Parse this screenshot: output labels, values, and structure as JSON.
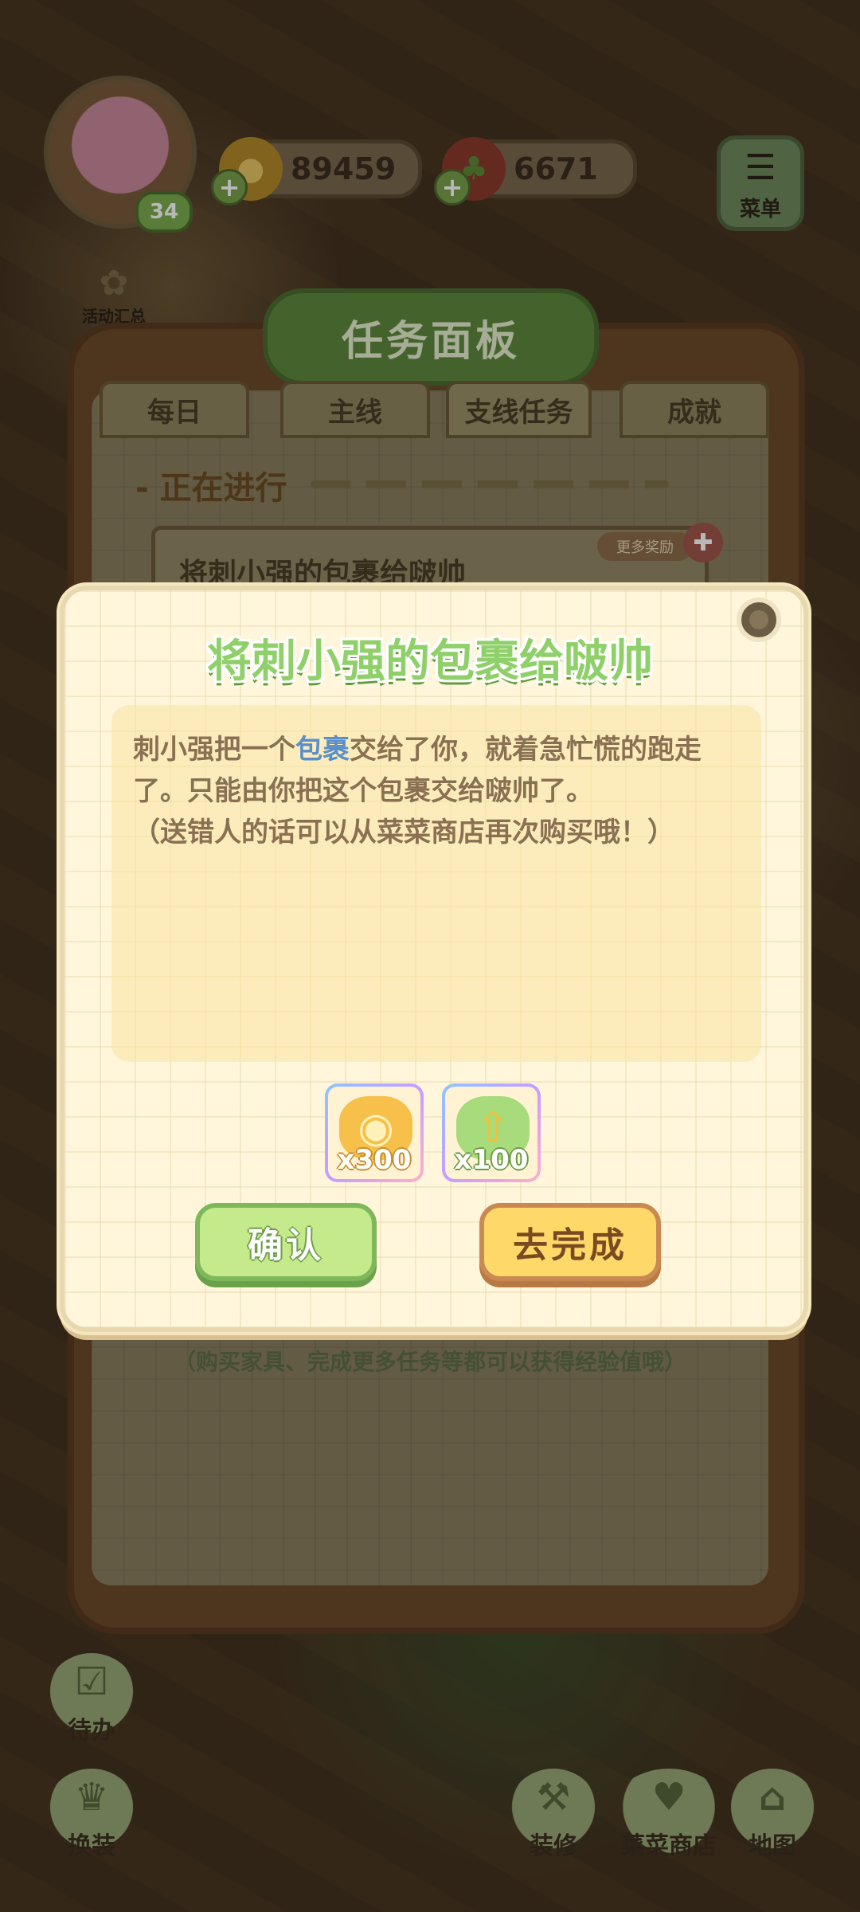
{
  "hud": {
    "level": "34",
    "coins": "89459",
    "vegetables": "6671",
    "menu_label": "菜单",
    "activity_label": "活动汇总"
  },
  "task_board": {
    "title": "任务面板",
    "tabs": [
      {
        "label": "每日"
      },
      {
        "label": "主线"
      },
      {
        "label": "支线任务"
      },
      {
        "label": "成就"
      }
    ],
    "section_title": "正在进行",
    "task_name": "将刺小强的包裹给啵帅",
    "more_reward_label": "更多奖励",
    "exp_hint": "（购买家具、完成更多任务等都可以获得经验值哦）"
  },
  "dialog": {
    "title": "将刺小强的包裹给啵帅",
    "desc_part1": "刺小强把一个",
    "desc_highlight": "包裹",
    "desc_part2": "交给了你，就着急忙慌的跑走了。只能由你把这个包裹交给啵帅了。",
    "desc_note": "（送错人的话可以从菜菜商店再次购买哦！）",
    "rewards": [
      {
        "icon": "gold-coins-icon",
        "qty": "x300"
      },
      {
        "icon": "exp-veggie-icon",
        "qty": "x100"
      }
    ],
    "confirm_label": "确认",
    "go_complete_label": "去完成"
  },
  "bottom_nav": {
    "todo_label": "待办",
    "dress_label": "换装",
    "decorate_label": "装修",
    "shop_label": "菜菜商店",
    "map_label": "地图"
  },
  "colors": {
    "dialog_title": "#8fd06a",
    "highlight": "#5b8fc9",
    "confirm_button": "#c5ea8c",
    "go_button": "#ffd86a"
  }
}
